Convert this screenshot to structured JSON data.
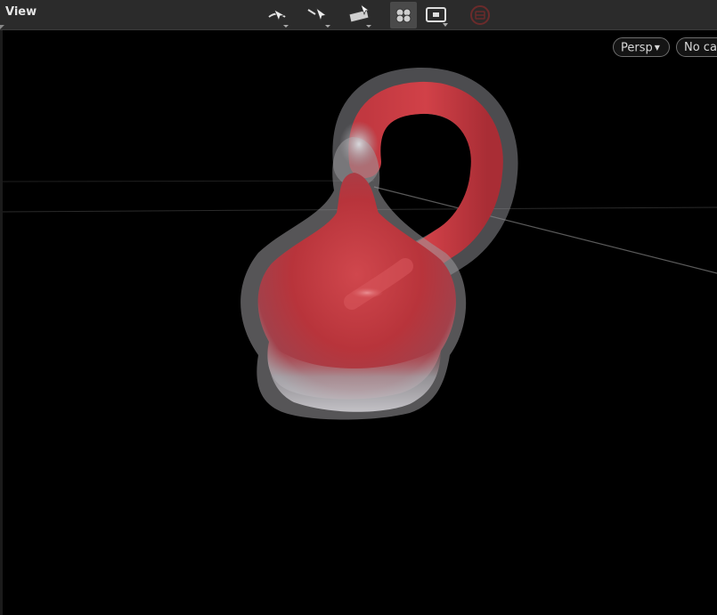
{
  "header": {
    "title": "View"
  },
  "toolbar": {
    "tools": [
      {
        "icon": "orbit-view-icon"
      },
      {
        "icon": "select-arrow-icon"
      },
      {
        "icon": "transform-handle-icon"
      },
      {
        "icon": "snapping-icon",
        "active": true
      },
      {
        "icon": "frame-view-icon"
      },
      {
        "icon": "disabled-stop-icon"
      }
    ]
  },
  "viewport": {
    "projection_label": "Persp",
    "camera_label": "No ca"
  },
  "colors": {
    "toolbar_bg": "#2b2b2b",
    "viewport_bg": "#000000",
    "object_red": "#c0353d",
    "object_ghost": "#a9a9ae"
  }
}
